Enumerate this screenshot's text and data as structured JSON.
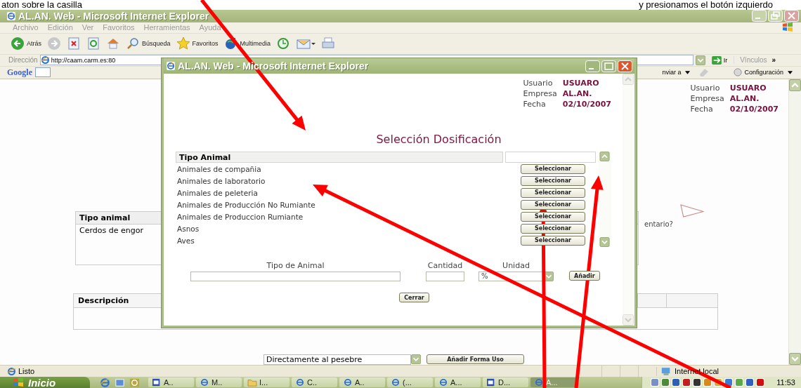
{
  "caption": [
    {
      "text": "aton sobre la casilla"
    },
    {
      "text": "y presionamos el botón izquierdo"
    }
  ],
  "window": {
    "title": "AL.AN. Web - Microsoft Internet Explorer"
  },
  "menu": [
    "Archivo",
    "Edición",
    "Ver",
    "Favoritos",
    "Herramientas",
    "Ayuda"
  ],
  "toolbar": [
    {
      "kind": "back",
      "label": "Atrás"
    },
    {
      "kind": "forward"
    },
    {
      "kind": "stop"
    },
    {
      "kind": "refresh"
    },
    {
      "kind": "home"
    },
    {
      "kind": "search",
      "label": "Búsqueda"
    },
    {
      "kind": "favorites",
      "label": "Favoritos"
    },
    {
      "kind": "media",
      "label": "Multimedia"
    },
    {
      "kind": "history"
    },
    {
      "kind": "mail"
    },
    {
      "kind": "print"
    }
  ],
  "address": {
    "label": "Dirección",
    "value": "http://caam.carm.es:80",
    "go": "Ir",
    "links": "Vínculos",
    "more": "»"
  },
  "google_bar": {
    "logo": "Google",
    "send": "nviar a",
    "settings": "Configuración"
  },
  "page": {
    "user_info": [
      {
        "label": "Usuario",
        "value": "USUARO"
      },
      {
        "label": "Empresa",
        "value": "AL.AN."
      },
      {
        "label": "Fecha",
        "value": "02/10/2007"
      }
    ],
    "animal_panel": {
      "header": "Tipo animal",
      "value": "Cerdos de engor"
    },
    "question": "entario?",
    "description_header": "Descripción",
    "use_select": "Directamente al pesebre",
    "add_use_button": "Añadir Forma Uso"
  },
  "popup": {
    "title": "AL.AN. Web - Microsoft Internet Explorer",
    "user_info": [
      {
        "label": "Usuario",
        "value": "USUARO"
      },
      {
        "label": "Empresa",
        "value": "AL.AN."
      },
      {
        "label": "Fecha",
        "value": "02/10/2007"
      }
    ],
    "heading": "Selección Dosificación",
    "table": {
      "columns": [
        "Tipo Animal"
      ],
      "rows": [
        {
          "name": "Animales de compañia",
          "button": "Seleccionar"
        },
        {
          "name": "Animales de laboratorio",
          "button": "Seleccionar"
        },
        {
          "name": "Animales de peleteria",
          "button": "Seleccionar"
        },
        {
          "name": "Animales de Producción No Rumiante",
          "button": "Seleccionar"
        },
        {
          "name": "Animales de Produccion Rumiante",
          "button": "Seleccionar"
        },
        {
          "name": "Asnos",
          "button": "Seleccionar"
        },
        {
          "name": "Aves",
          "button": "Seleccionar"
        }
      ]
    },
    "form": {
      "type_label": "Tipo de Animal",
      "quantity_label": "Cantidad",
      "unit_label": "Unidad",
      "unit_value": "%",
      "add_button": "Añadir"
    },
    "close_button": "Cerrar"
  },
  "status_bar": {
    "text": "Listo",
    "zone": "Internet local"
  },
  "taskbar": {
    "start": "Inicio",
    "tasks": [
      {
        "kind": "word",
        "label": "A..",
        "selected": false
      },
      {
        "kind": "ie",
        "label": "M..",
        "selected": false
      },
      {
        "kind": "folder",
        "label": "I...",
        "selected": false
      },
      {
        "kind": "ie",
        "label": "C..",
        "selected": false
      },
      {
        "kind": "ie",
        "label": "A..",
        "selected": false
      },
      {
        "kind": "ie",
        "label": "(...",
        "selected": false
      },
      {
        "kind": "ie",
        "label": "A...",
        "selected": false
      },
      {
        "kind": "word",
        "label": "D...",
        "selected": false
      },
      {
        "kind": "ie",
        "label": "A...",
        "selected": true
      }
    ],
    "clock": "11:53"
  }
}
